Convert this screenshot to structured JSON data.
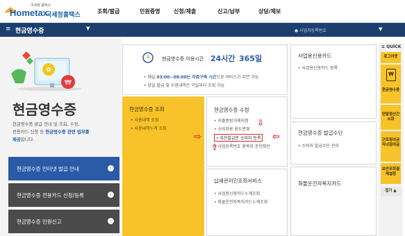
{
  "header": {
    "logo_sub": "국세청 홈택스",
    "logo_home": "Hometax",
    "logo_ko": "국세청홈택스",
    "menu": [
      "조회/발급",
      "민원증명",
      "신청/제출",
      "신고/납부",
      "상담/제보"
    ]
  },
  "navbar": {
    "title": "현금영수증",
    "right_text": "사업자등록번호"
  },
  "left": {
    "title": "현금영수증",
    "desc_1": "현금영수증 발급 안내 및 조회, 수정,",
    "desc_2": "전용카드 신청 등 ",
    "desc_highlight": "현금영수증 관련 업무를",
    "desc_3": "제공",
    "desc_4": "합니다.",
    "buttons": [
      "현금영수증 인터넷 발급 안내",
      "현금영수증 전용카드 신청/등록",
      "현금영수증 민원신고"
    ]
  },
  "service_box": {
    "label": "현금영수증 이용시간",
    "hours": "24시간",
    "days": "365일",
    "note1_prefix": "매일 ",
    "note1_time": "03:00~08:00는 자료구축 시간",
    "note1_suffix": "으로 서비스가 지연 가능",
    "note2": "당일 발급 및 수정내역은 익일부터 조회 가능"
  },
  "cards": {
    "business_card": {
      "title": "사업용신용카드",
      "items": [
        "사업용신용카드 등록"
      ]
    },
    "inquiry": {
      "title": "현금영수증 조회",
      "items": [
        "사용내역 조회",
        "사용내역누계 조회"
      ]
    },
    "modify": {
      "title": "현금영수증 수정",
      "items": [
        "지출증빙거래지정",
        "소비자용 용도변경",
        "자진발급분 소비자 등록",
        "사업등록번호 중복자 본인확인"
      ]
    },
    "means": {
      "title": "현금영수증 발급수단",
      "items": [
        "소비자 발급수단 관리"
      ]
    },
    "cultural": {
      "title": "화물운전자복지카드"
    },
    "tax_service": {
      "title": "납세관리인조회서비스",
      "items": [
        "사업용신용카드누계조회",
        "화물운전자복지카드누계조회"
      ]
    }
  },
  "quick": {
    "label": "QUICK",
    "items": [
      "로그아웃",
      "현금영수증",
      "연말정산간소화",
      "근로장려금자녀장려금",
      "보안우회결제설정"
    ],
    "collapse": "접기"
  },
  "colors": {
    "accent_yellow": "#f8c32a",
    "navy": "#1c3f6e",
    "button_blue": "#2b5aa7",
    "arrow_red": "#e0262b"
  }
}
